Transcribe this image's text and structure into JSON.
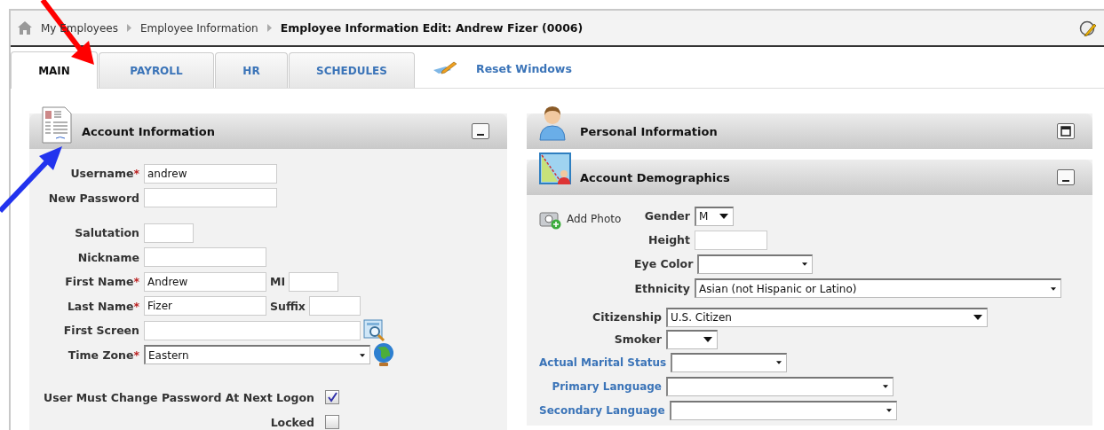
{
  "breadcrumb": {
    "items": [
      "My Employees",
      "Employee Information"
    ],
    "current": "Employee Information Edit: Andrew Fizer (0006)"
  },
  "tabs": [
    {
      "label": "MAIN",
      "selected": true
    },
    {
      "label": "PAYROLL",
      "selected": false
    },
    {
      "label": "HR",
      "selected": false
    },
    {
      "label": "SCHEDULES",
      "selected": false
    }
  ],
  "reset_windows": "Reset Windows",
  "account_information": {
    "title": "Account Information",
    "expanded": true,
    "fields": [
      {
        "label": "Username",
        "required": "*",
        "kind": "text",
        "value": "andrew"
      },
      {
        "label": "New Password",
        "kind": "text"
      },
      {
        "label": "Salutation",
        "kind": "text"
      },
      {
        "label": "Nickname",
        "kind": "text"
      },
      {
        "label": "First Name",
        "required": "*",
        "kind": "text",
        "value": "Andrew",
        "extra": {
          "label": "MI",
          "kind": "text"
        }
      },
      {
        "label": "Last Name",
        "required": "*",
        "kind": "text",
        "value": "Fizer",
        "extra": {
          "label": "Suffix",
          "kind": "text"
        }
      },
      {
        "label": "First Screen",
        "kind": "lookup"
      },
      {
        "label": "Time Zone",
        "required": "*",
        "kind": "zone",
        "value": "Eastern"
      }
    ],
    "checkboxes": [
      {
        "label": "User Must Change Password At Next Logon",
        "checked": true
      },
      {
        "label": "Locked",
        "checked": false
      }
    ]
  },
  "personal_information": {
    "title": "Personal Information",
    "expanded": false
  },
  "account_demographics": {
    "title": "Account Demographics",
    "expanded": true,
    "add_photo": "Add Photo",
    "fields": [
      {
        "label": "Gender",
        "kind": "select",
        "value": "M",
        "link": false
      },
      {
        "label": "Height",
        "kind": "text",
        "link": false
      },
      {
        "label": "Eye Color",
        "kind": "select",
        "link": false
      },
      {
        "label": "Ethnicity",
        "kind": "select",
        "value": "Asian (not Hispanic or Latino)",
        "link": false
      }
    ],
    "more_fields": [
      {
        "label": "Citizenship",
        "kind": "select",
        "value": "U.S. Citizen",
        "link": false
      },
      {
        "label": "Smoker",
        "kind": "select",
        "link": false
      },
      {
        "label": "Actual Marital Status",
        "kind": "select",
        "link": true
      },
      {
        "label": "Primary Language",
        "kind": "select",
        "link": true
      },
      {
        "label": "Secondary Language",
        "kind": "select",
        "link": true
      }
    ]
  }
}
